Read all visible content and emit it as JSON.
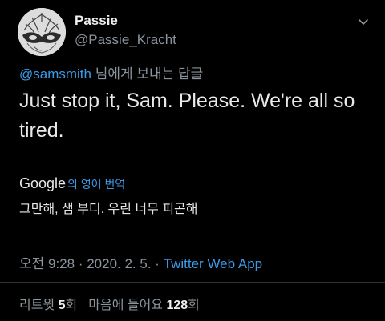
{
  "user": {
    "display_name": "Passie",
    "handle": "@Passie_Kracht",
    "avatar_icon": "masquerade-mask-avatar-icon"
  },
  "reply": {
    "mention": "@samsmith",
    "suffix": " 님에게 보내는 답글"
  },
  "tweet": {
    "text": "Just stop it, Sam. Please. We're all so tired."
  },
  "translation": {
    "provider": "Google",
    "label": "의 영어 번역",
    "text": "그만해, 샘 부디. 우린 너무 피곤해"
  },
  "meta": {
    "time": "오전 9:28",
    "date": "2020. 2. 5.",
    "separator": " · ",
    "app": "Twitter Web App"
  },
  "stats": {
    "retweets_label": "리트윗 ",
    "retweets_count": "5",
    "retweets_unit": "회",
    "likes_label": "마음에 들어요 ",
    "likes_count": "128",
    "likes_unit": "회"
  },
  "icons": {
    "caret": "chevron-down-icon"
  },
  "colors": {
    "background": "#000000",
    "link": "#3b9ae8",
    "muted": "#8a949c",
    "text": "#e9e9e9"
  }
}
